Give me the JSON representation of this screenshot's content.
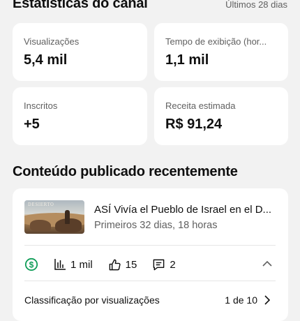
{
  "header": {
    "title": "Estatísticas do canal",
    "range": "Últimos 28 dias"
  },
  "stats": [
    {
      "label": "Visualizações",
      "value": "5,4 mil"
    },
    {
      "label": "Tempo de exibição (hor...",
      "value": "1,1 mil"
    },
    {
      "label": "Inscritos",
      "value": "+5"
    },
    {
      "label": "Receita estimada",
      "value": "R$ 91,24"
    }
  ],
  "recent": {
    "title": "Conteúdo publicado recentemente",
    "video": {
      "thumbnail_text": "DESIERTO",
      "title": "ASÍ Vivía el Pueblo de Israel en el D...",
      "subtitle": "Primeiros 32 dias, 18 horas"
    },
    "metrics": {
      "views": "1 mil",
      "likes": "15",
      "comments": "2"
    },
    "sort": {
      "label": "Classificação por visualizações",
      "pages": "1 de 10"
    }
  },
  "colors": {
    "accent_green": "#0f9d58",
    "background": "#f2f2f2",
    "card": "#ffffff",
    "secondary_text": "#606060"
  }
}
